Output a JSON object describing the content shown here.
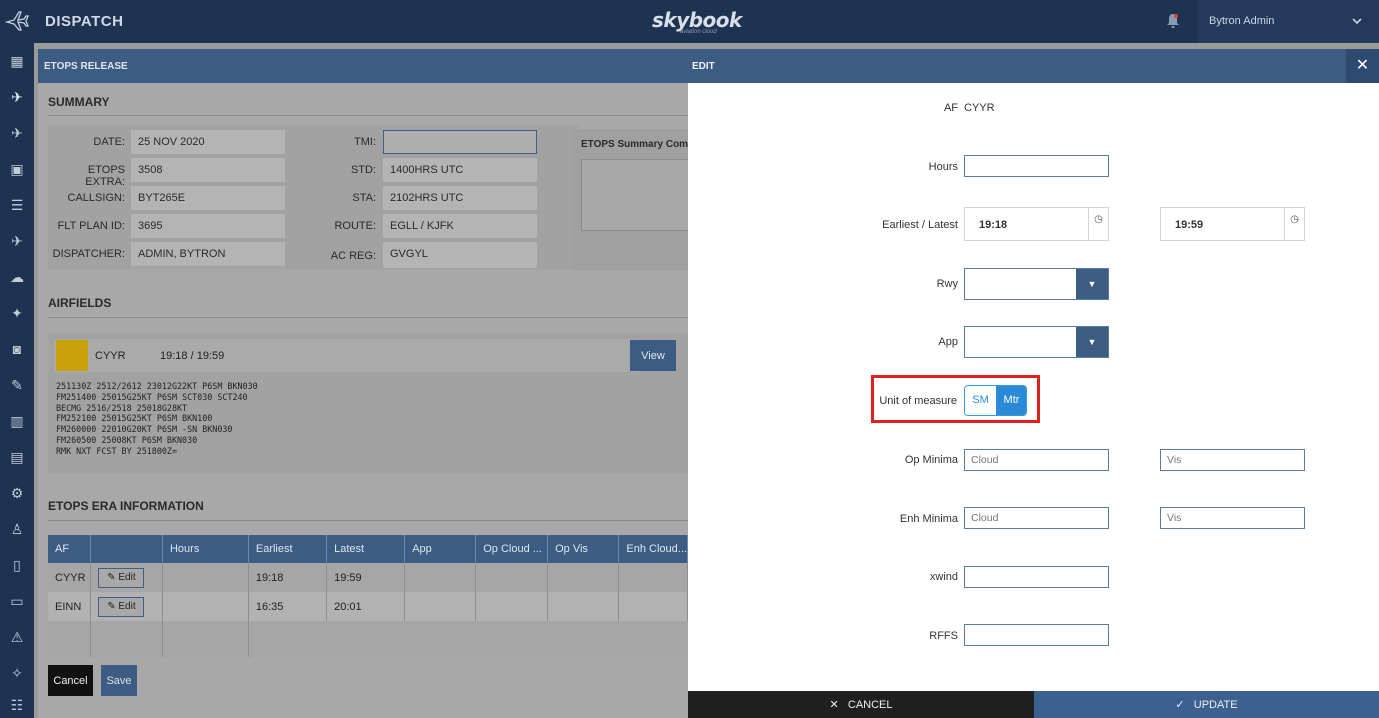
{
  "topbar": {
    "app_title": "DISPATCH",
    "brand": "skybook",
    "brand_sub": "aviation cloud",
    "user_name": "Bytron Admin"
  },
  "etops": {
    "header": "ETOPS RELEASE",
    "summary_title": "SUMMARY",
    "fields": {
      "date_label": "DATE:",
      "date_value": "25 NOV 2020",
      "etops_extra_label": "ETOPS EXTRA:",
      "etops_extra_value": "3508",
      "callsign_label": "CALLSIGN:",
      "callsign_value": "BYT265E",
      "flt_plan_label": "FLT PLAN ID:",
      "flt_plan_value": "3695",
      "dispatcher_label": "DISPATCHER:",
      "dispatcher_value": "ADMIN, BYTRON",
      "tmi_label": "TMI:",
      "tmi_value": "",
      "std_label": "STD:",
      "std_value": "1400HRS UTC",
      "sta_label": "STA:",
      "sta_value": "2102HRS UTC",
      "route_label": "ROUTE:",
      "route_value": "EGLL / KJFK",
      "acreg_label": "AC REG:",
      "acreg_value": "GVGYL"
    },
    "comments_title": "ETOPS Summary Comments",
    "airfields_title": "AIRFIELDS",
    "airfield": {
      "code": "CYYR",
      "times": "19:18 / 19:59",
      "view_label": "View",
      "swatch_color": "#c8a20b",
      "taf": "251130Z 2512/2612 23012G22KT P6SM BKN030\nFM251400 25015G25KT P6SM SCT030 SCT240\nBECMG 2516/2518 25018G28KT\nFM252100 25015G25KT P6SM BKN100\nFM260000 22010G20KT P6SM -SN BKN030\nFM260500 25008KT P6SM BKN030\nRMK NXT FCST BY 251800Z="
    },
    "era_title": "ETOPS ERA INFORMATION",
    "era_columns": [
      "AF",
      "",
      "Hours",
      "Earliest",
      "Latest",
      "App",
      "Op Cloud ...",
      "Op Vis",
      "Enh Cloud..."
    ],
    "era_rows": [
      {
        "af": "CYYR",
        "edit": "Edit",
        "hours": "",
        "earliest": "19:18",
        "latest": "19:59"
      },
      {
        "af": "EINN",
        "edit": "Edit",
        "hours": "",
        "earliest": "16:35",
        "latest": "20:01"
      }
    ],
    "cancel_label": "Cancel",
    "save_label": "Save"
  },
  "edit": {
    "header": "EDIT",
    "af_label": "AF",
    "af_value": "CYYR",
    "hours_label": "Hours",
    "earliest_latest_label": "Earliest / Latest",
    "earliest_value": "19:18",
    "latest_value": "19:59",
    "rwy_label": "Rwy",
    "app_label": "App",
    "uom_label": "Unit of measure",
    "uom_options": [
      "SM",
      "Mtr"
    ],
    "uom_selected": "Mtr",
    "op_minima_label": "Op Minima",
    "enh_minima_label": "Enh Minima",
    "cloud_placeholder": "Cloud",
    "vis_placeholder": "Vis",
    "xwind_label": "xwind",
    "rffs_label": "RFFS",
    "cancel_label": "CANCEL",
    "update_label": "UPDATE",
    "highlight_color": "#e0201a"
  }
}
